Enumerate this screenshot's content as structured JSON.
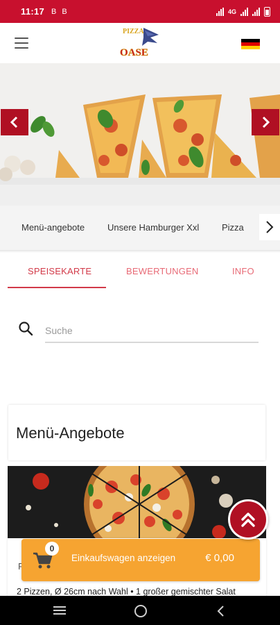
{
  "status_bar": {
    "time": "11:17",
    "left_icons": [
      "B",
      "B"
    ],
    "network": "4G"
  },
  "header": {
    "menu_icon": "hamburger-icon",
    "logo_icon": "pizza-oase-logo",
    "logo_text_top": "PIZZA",
    "logo_text_bottom": "OASE",
    "language_flag": "germany-flag"
  },
  "banner": {
    "prev_icon": "chevron-left-icon",
    "next_icon": "chevron-right-icon"
  },
  "categories": {
    "items": [
      "Menü-angebote",
      "Unsere Hamburger Xxl",
      "Pizza"
    ],
    "next_icon": "chevron-right-icon"
  },
  "tabs": [
    {
      "label": "SPEISEKARTE",
      "active": true
    },
    {
      "label": "BEWERTUNGEN",
      "active": false
    },
    {
      "label": "INFO",
      "active": false
    }
  ],
  "search": {
    "placeholder": "Suche",
    "value": ""
  },
  "section": {
    "title": "Menü-Angebote"
  },
  "product": {
    "name_partial": "F",
    "description": "2 Pizzen, Ø 26cm nach Wahl • 1 großer gemischter Salat"
  },
  "cart": {
    "count": "0",
    "label": "Einkaufswagen anzeigen",
    "total": "€ 0,00"
  },
  "colors": {
    "brand_red": "#c8102e",
    "tab_active": "#d23a49",
    "cart_orange": "#f6a431"
  }
}
